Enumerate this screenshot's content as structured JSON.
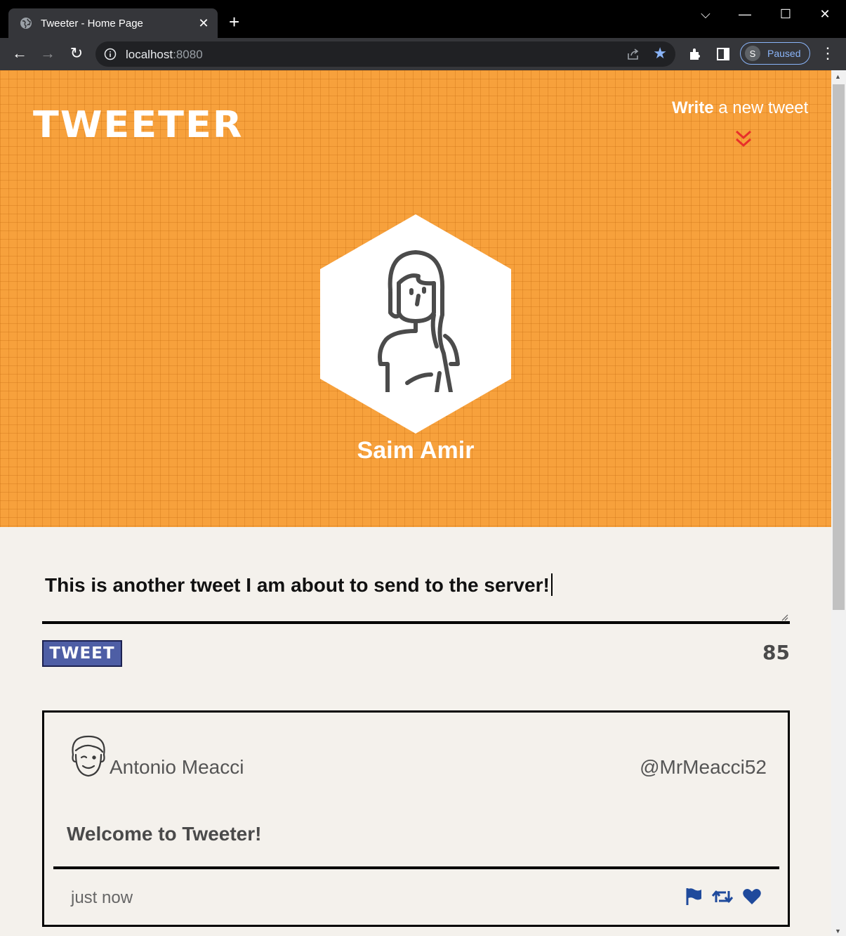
{
  "browser": {
    "tab_title": "Tweeter - Home Page",
    "url_host": "localhost",
    "url_port": ":8080",
    "profile_initial": "S",
    "profile_status": "Paused"
  },
  "header": {
    "logo": "TWEETER",
    "compose_bold": "Write",
    "compose_rest": " a new tweet",
    "chevron_color": "#e8302a"
  },
  "profile": {
    "name": "Saim Amir"
  },
  "composer": {
    "text": "This is another tweet I am about to send to the server!",
    "button_label": "TWEET",
    "char_counter": "85"
  },
  "tweets": [
    {
      "author_name": "Antonio Meacci",
      "handle": "@MrMeacci52",
      "body": "Welcome to Tweeter!",
      "time": "just now",
      "actions": [
        "flag-icon",
        "retweet-icon",
        "heart-icon"
      ],
      "action_color": "#1f4a9c"
    }
  ],
  "colors": {
    "hero_bg": "#f7a13c",
    "page_bg": "#f4f1ec",
    "button_bg": "#4e5ea5"
  }
}
